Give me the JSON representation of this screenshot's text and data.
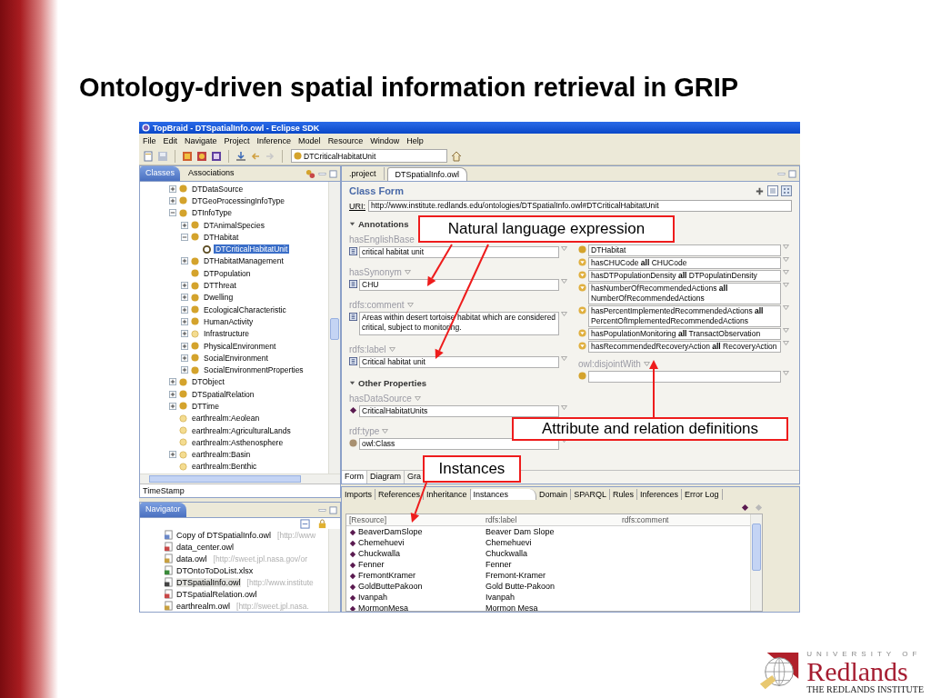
{
  "slide": {
    "title": "Ontology-driven spatial information retrieval in GRIP"
  },
  "window": {
    "title": "TopBraid - DTSpatialInfo.owl - Eclipse SDK",
    "menu": [
      "File",
      "Edit",
      "Navigate",
      "Project",
      "Inference",
      "Model",
      "Resource",
      "Window",
      "Help"
    ],
    "class_field": "DTCriticalHabitatUnit"
  },
  "classes_view": {
    "tabs": [
      {
        "label": "Classes",
        "selected": true
      },
      {
        "label": "Associations",
        "selected": false
      }
    ],
    "tree": [
      {
        "label": "DTDataSource",
        "kind": "class",
        "expanded": false,
        "selected": false
      },
      {
        "label": "DTGeoProcessingInfoType",
        "kind": "class",
        "expanded": false,
        "selected": false
      },
      {
        "label": "DTInfoType",
        "kind": "class",
        "expanded": true,
        "selected": false,
        "children": [
          {
            "label": "DTAnimalSpecies",
            "kind": "class",
            "expanded": false,
            "selected": false
          },
          {
            "label": "DTHabitat",
            "kind": "class",
            "expanded": true,
            "selected": false,
            "children": [
              {
                "label": "DTCriticalHabitatUnit",
                "kind": "current",
                "selected": true
              }
            ]
          },
          {
            "label": "DTHabitatManagement",
            "kind": "class",
            "expanded": false,
            "selected": false
          },
          {
            "label": "DTPopulation",
            "kind": "class",
            "selected": false
          },
          {
            "label": "DTThreat",
            "kind": "class",
            "expanded": false,
            "selected": false
          },
          {
            "label": "Dwelling",
            "kind": "class",
            "expanded": false,
            "selected": false
          },
          {
            "label": "EcologicalCharacteristic",
            "kind": "class",
            "expanded": false,
            "selected": false
          },
          {
            "label": "HumanActivity",
            "kind": "class",
            "expanded": false,
            "selected": false
          },
          {
            "label": "Infrastructure",
            "kind": "imported",
            "expanded": false,
            "selected": false
          },
          {
            "label": "PhysicalEnvironment",
            "kind": "class",
            "expanded": false,
            "selected": false
          },
          {
            "label": "SocialEnvironment",
            "kind": "class",
            "expanded": false,
            "selected": false
          },
          {
            "label": "SocialEnvironmentProperties",
            "kind": "class",
            "expanded": false,
            "selected": false
          }
        ]
      },
      {
        "label": "DTObject",
        "kind": "class",
        "expanded": false,
        "selected": false
      },
      {
        "label": "DTSpatialRelation",
        "kind": "class",
        "expanded": false,
        "selected": false
      },
      {
        "label": "DTTime",
        "kind": "class",
        "expanded": false,
        "selected": false
      },
      {
        "label": "earthrealm:Aeolean",
        "kind": "imported",
        "selected": false
      },
      {
        "label": "earthrealm:AgriculturalLands",
        "kind": "imported",
        "selected": false
      },
      {
        "label": "earthrealm:Asthenosphere",
        "kind": "imported",
        "selected": false
      },
      {
        "label": "earthrealm:Basin",
        "kind": "imported",
        "expanded": false,
        "selected": false
      },
      {
        "label": "earthrealm:Benthic",
        "kind": "imported",
        "selected": false
      }
    ],
    "filter": "TimeStamp"
  },
  "navigator": {
    "title": "Navigator",
    "files": [
      {
        "name": "Copy of DTSpatialInfo.owl",
        "uri": "[http://www",
        "kind": "owl",
        "selected": false
      },
      {
        "name": "data_center.owl",
        "kind": "owl_red",
        "selected": false
      },
      {
        "name": "data.owl",
        "uri": "[http://sweet.jpl.nasa.gov/or",
        "kind": "owl_link",
        "selected": false
      },
      {
        "name": "DTOntoToDoList.xlsx",
        "kind": "xlsx",
        "selected": false
      },
      {
        "name": "DTSpatialInfo.owl",
        "uri": "[http://www.institute",
        "kind": "owl_open",
        "selected": true
      },
      {
        "name": "DTSpatialRelation.owl",
        "kind": "owl_red",
        "selected": false
      },
      {
        "name": "earthrealm.owl",
        "uri": "[http://sweet.jpl.nasa.",
        "kind": "owl_link",
        "selected": false
      }
    ]
  },
  "editor": {
    "tabs": [
      {
        "label": ".project",
        "selected": false
      },
      {
        "label": "DTSpatialInfo.owl",
        "selected": true
      }
    ],
    "form_title": "Class Form",
    "uri_label": "URI:",
    "uri": "http://www.institute.redlands.edu/ontologies/DTSpatialInfo.owl#DTCriticalHabitatUnit",
    "left": [
      {
        "section": "Annotations",
        "expanded": true,
        "properties": [
          {
            "label": "hasEnglishBase",
            "dropdown": false,
            "values": [
              {
                "kind": "literal",
                "text": "critical habitat unit"
              }
            ]
          },
          {
            "label": "hasSynonym",
            "dropdown": true,
            "values": [
              {
                "kind": "literal",
                "text": "CHU"
              }
            ]
          },
          {
            "label": "rdfs:comment",
            "dropdown": true,
            "values": [
              {
                "kind": "literal",
                "text": "Areas within desert tortoise habitat which are considered critical, subject to monitoring."
              }
            ]
          },
          {
            "label": "rdfs:label",
            "dropdown": true,
            "values": [
              {
                "kind": "literal",
                "text": "Critical habitat unit"
              }
            ]
          }
        ]
      },
      {
        "section": "Other Properties",
        "expanded": true,
        "properties": [
          {
            "label": "hasDataSource",
            "dropdown": true,
            "values": [
              {
                "kind": "instance",
                "text": "CriticalHabitatUnits"
              }
            ]
          },
          {
            "label": "rdf:type",
            "dropdown": true,
            "values": [
              {
                "kind": "type",
                "text": "owl:Class"
              }
            ]
          }
        ]
      }
    ],
    "right": [
      {
        "values": [
          {
            "kind": "class",
            "text": "DTHabitat"
          },
          {
            "kind": "restriction",
            "text": "hasCHUCode **all** CHUCode"
          },
          {
            "kind": "restriction",
            "text": "hasDTPopulationDensity **all** DTPopulatinDensity"
          },
          {
            "kind": "restriction",
            "text": "hasNumberOfRecommendedActions **all** NumberOfRecommendedActions"
          },
          {
            "kind": "restriction",
            "text": "hasPercentImplementedRecommendedActions **all** PercentOfImplementedRecommendedActions"
          },
          {
            "kind": "restriction",
            "text": "hasPopulationMonitoring **all** TransactObservation"
          },
          {
            "kind": "restriction",
            "text": "hasRecommendedRecoveryAction **all** RecoveryAction"
          }
        ]
      },
      {
        "label": "owl:disjointWith",
        "values": [
          {
            "kind": "class"
          }
        ]
      }
    ],
    "form_tabs": [
      {
        "label": "Form",
        "selected": true
      },
      {
        "label": "Diagram",
        "selected": false
      },
      {
        "label": "Gra",
        "selected": false
      }
    ]
  },
  "bottom": {
    "tabs": [
      {
        "label": "Imports",
        "selected": false
      },
      {
        "label": "References",
        "selected": false
      },
      {
        "label": "Inheritance",
        "selected": false
      },
      {
        "label": "Instances",
        "selected": true
      },
      {
        "label": "Domain",
        "selected": false
      },
      {
        "label": "SPARQL",
        "selected": false
      },
      {
        "label": "Rules",
        "selected": false
      },
      {
        "label": "Inferences",
        "selected": false
      },
      {
        "label": "Error Log",
        "selected": false
      }
    ],
    "columns": [
      "[Resource]",
      "rdfs:label",
      "rdfs:comment"
    ],
    "rows": [
      {
        "resource": "BeaverDamSlope",
        "label": "Beaver Dam Slope"
      },
      {
        "resource": "Chemehuevi",
        "label": "Chemehuevi"
      },
      {
        "resource": "Chuckwalla",
        "label": "Chuckwalla"
      },
      {
        "resource": "Fenner",
        "label": "Fenner"
      },
      {
        "resource": "FremontKramer",
        "label": "Fremont-Kramer"
      },
      {
        "resource": "GoldButtePakoon",
        "label": "Gold Butte-Pakoon"
      },
      {
        "resource": "Ivanpah",
        "label": "Ivanpah"
      },
      {
        "resource": "MormonMesa",
        "label": "Mormon Mesa"
      }
    ]
  },
  "callouts": [
    "Natural language expression",
    "Attribute and relation definitions",
    "Instances"
  ],
  "logo": {
    "line1": "UNIVERSITY OF",
    "line2": "Redlands",
    "line3": "THE REDLANDS INSTITUTE"
  }
}
